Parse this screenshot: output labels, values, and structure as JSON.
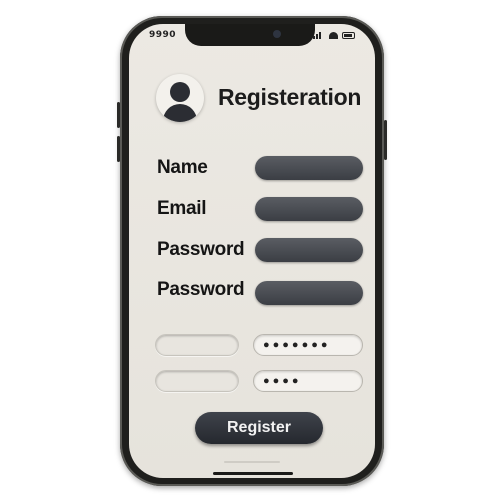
{
  "status_bar": {
    "time": "9990"
  },
  "header": {
    "title": "Registeration"
  },
  "form": {
    "rows": [
      {
        "label": "Name"
      },
      {
        "label": "Email"
      },
      {
        "label": "Password"
      },
      {
        "label": "Password"
      }
    ],
    "light_field_1_placeholder": "",
    "light_field_2_placeholder": "",
    "password_mask_1": "●●●●●●●",
    "password_mask_2": "●●●●"
  },
  "actions": {
    "register_label": "Register"
  },
  "colors": {
    "field_dark": "#3b3e44",
    "button": "#25282e",
    "screen_bg": "#ece9e3"
  }
}
